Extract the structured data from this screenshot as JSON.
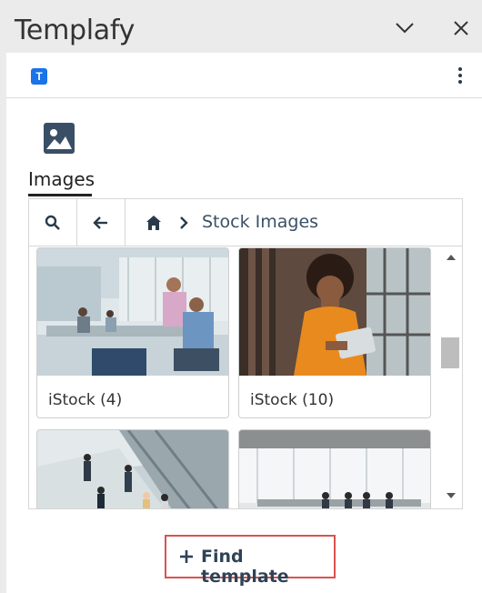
{
  "window": {
    "title": "Templafy",
    "minimize_icon": "chevron-down-icon",
    "close_icon": "close-icon"
  },
  "header": {
    "logo_letter": "T",
    "menu_icon": "more-vertical-icon",
    "logo_color": "#1a73e8"
  },
  "section": {
    "icon": "image-icon",
    "tab_label": "Images"
  },
  "browser": {
    "breadcrumb": {
      "home_icon": "home-icon",
      "current": "Stock Images"
    },
    "items": [
      {
        "label": "iStock (4)"
      },
      {
        "label": "iStock (10)"
      },
      {
        "label": ""
      },
      {
        "label": ""
      }
    ]
  },
  "footer": {
    "find_label": "Find template"
  },
  "colors": {
    "accent": "#3a5068",
    "highlight_border": "#d9534f"
  }
}
